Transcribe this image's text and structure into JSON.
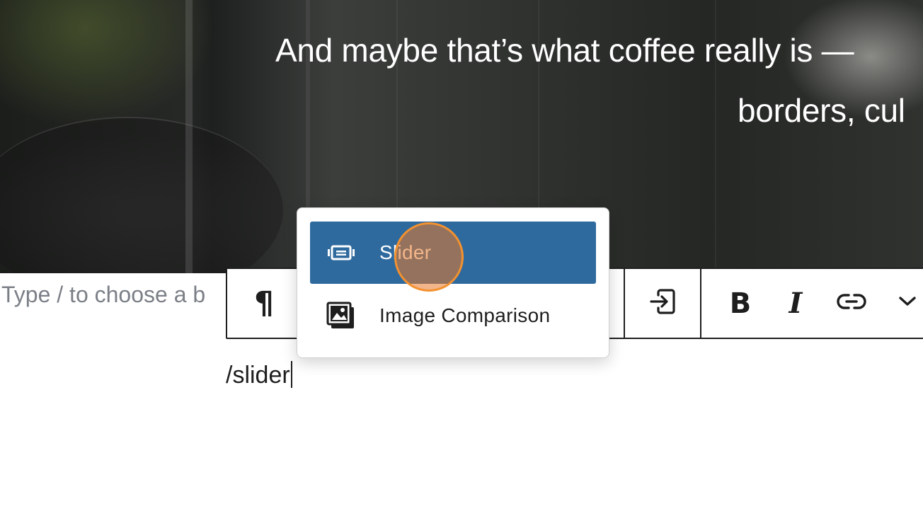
{
  "cover": {
    "line1": "And maybe that’s what coffee really is —",
    "line2": "borders, cul"
  },
  "editor": {
    "placeholder": "Type / to choose a b",
    "typed_text": "/slider"
  },
  "toolbar": {
    "paragraph_icon": "pilcrow-icon",
    "paragraph_glyph": "¶",
    "transform_icon": "login-arrow-icon",
    "bold_glyph": "B",
    "italic_glyph": "I",
    "link_icon": "link-icon",
    "more_icon": "chevron-down-icon"
  },
  "autocomplete": {
    "options": [
      {
        "label": "Slider",
        "icon": "slider-icon",
        "selected": true
      },
      {
        "label": "Image Comparison",
        "icon": "image-comparison-icon",
        "selected": false
      }
    ],
    "selected_bg": "#2f6a9e"
  },
  "colors": {
    "click_indicator": "#f3912f",
    "toolbar_border": "#1e1e1e"
  }
}
